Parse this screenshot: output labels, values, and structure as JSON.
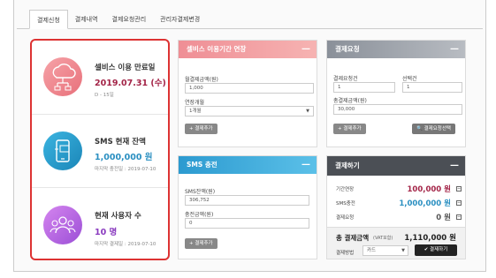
{
  "tabs": [
    "결제신청",
    "결제내역",
    "결제요청관리",
    "관리자결제변경"
  ],
  "stats": [
    {
      "title": "셀비스 이용 만료일",
      "value": "2019.07.31 (수)",
      "sub": "D - 15일",
      "value_color": "#a32447"
    },
    {
      "title": "SMS 현재 잔액",
      "value": "1,000,000 원",
      "sub": "마지막 충전일 : 2019-07-10",
      "value_color": "#2a8fc1"
    },
    {
      "title": "현재 사용자 수",
      "value": "10 명",
      "sub": "마지막 결제일 : 2019-07-10",
      "value_color": "#8a3bbf"
    }
  ],
  "extend": {
    "title": "셀비스 이용기간 연장",
    "amount_label": "월결제금액(원)",
    "amount_value": "1,000",
    "months_label": "연장개월",
    "months_value": "1개월",
    "add_button": "+  결제추가",
    "minus": "—"
  },
  "request": {
    "title": "결제요청",
    "count_label": "결제요청건",
    "count_value": "1",
    "select_label": "선택건",
    "select_value": "1",
    "total_label": "총결제금액(원)",
    "total_value": "30,000",
    "add_button": "+  결제추가",
    "select_button": "🔍  결제요청선택",
    "minus": "—"
  },
  "sms": {
    "title": "SMS 충전",
    "balance_label": "SMS잔액(원)",
    "balance_value": "306,752",
    "charge_label": "충전금액(원)",
    "charge_value": "0",
    "add_button": "+  결제추가",
    "minus": "—"
  },
  "pay": {
    "title": "결제하기",
    "rows": [
      {
        "label": "기간연장",
        "value": "100,000 원",
        "color": "#a32447"
      },
      {
        "label": "SMS충전",
        "value": "1,000,000 원",
        "color": "#2a8fc1"
      },
      {
        "label": "결제요청",
        "value": "0 원",
        "color": "#555555"
      }
    ],
    "total_label": "총 결제금액",
    "vat": "(VAT포함)",
    "total_value": "1,110,000 원",
    "method_label": "결제방법",
    "method_value": "카드",
    "pay_button": "결제하기",
    "minus": "—"
  }
}
